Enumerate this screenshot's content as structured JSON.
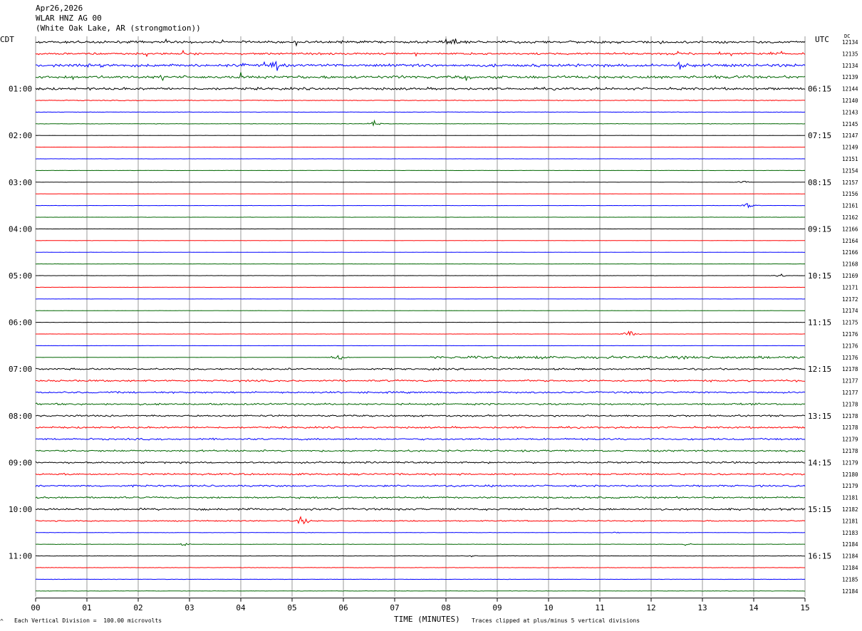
{
  "header": {
    "date": "Apr26,2026",
    "channel": "WLAR HNZ AG 00",
    "location": "(White Oak Lake, AR (strongmotion))"
  },
  "left_tz": "CDT",
  "right_tz": "UTC",
  "dc_label": "DC",
  "footer": {
    "scale_note": "Each Vertical Division =  100.00 microvolts",
    "clip_note": "Traces clipped at plus/minus 5 vertical divisions",
    "corner_mark": "^"
  },
  "colors": {
    "trace_cycle": [
      "#000000",
      "#ff0000",
      "#0000ff",
      "#006600"
    ],
    "grid": "#9a9a9a"
  },
  "chart_data": {
    "type": "helicorder",
    "xlabel": "TIME (MINUTES)",
    "xlim": [
      0,
      15
    ],
    "x_ticks": [
      "00",
      "01",
      "02",
      "03",
      "04",
      "05",
      "06",
      "07",
      "08",
      "09",
      "10",
      "11",
      "12",
      "13",
      "14",
      "15"
    ],
    "left_time_labels": [
      "01:00",
      "02:00",
      "03:00",
      "04:00",
      "05:00",
      "06:00",
      "07:00",
      "08:00",
      "09:00",
      "10:00",
      "11:00"
    ],
    "right_time_labels": [
      "06:15",
      "07:15",
      "08:15",
      "09:15",
      "10:15",
      "11:15",
      "12:15",
      "13:15",
      "14:15",
      "15:15",
      "16:15"
    ],
    "row_minutes": 15,
    "row_count": 48,
    "dc_values": [
      "12134",
      "12135",
      "12134",
      "12139",
      "12144",
      "12140",
      "12143",
      "12145",
      "12147",
      "12149",
      "12151",
      "12154",
      "12157",
      "12156",
      "12161",
      "12162",
      "12166",
      "12164",
      "12166",
      "12168",
      "12169",
      "12171",
      "12172",
      "12174",
      "12175",
      "12176",
      "12176",
      "12176",
      "12178",
      "12177",
      "12177",
      "12178",
      "12178",
      "12178",
      "12179",
      "12178",
      "12179",
      "12180",
      "12179",
      "12181",
      "12182",
      "12181",
      "12183",
      "12184",
      "12184",
      "12184",
      "12185",
      "12184"
    ],
    "noise_amplitude_divisions": [
      3,
      2.5,
      3.5,
      3.5,
      3,
      1,
      0.6,
      0.6,
      0.3,
      0.3,
      0.3,
      0.3,
      0.3,
      0.3,
      0.3,
      0.3,
      0.3,
      0.3,
      0.3,
      0.3,
      0.3,
      0.3,
      0.3,
      0.3,
      0.3,
      0.3,
      0.3,
      0.3,
      2.2,
      2.2,
      2.2,
      2.2,
      2.2,
      2.2,
      2.2,
      2.2,
      2.2,
      2.2,
      2.2,
      2.2,
      2.5,
      1.5,
      0.5,
      0.5,
      0.5,
      0.5,
      0.5,
      0.5
    ],
    "events": [
      {
        "row": 0,
        "minute": 8.1,
        "amp": 8
      },
      {
        "row": 2,
        "minute": 4.7,
        "amp": 8
      },
      {
        "row": 2,
        "minute": 12.6,
        "amp": 8
      },
      {
        "row": 7,
        "minute": 6.6,
        "amp": 3
      },
      {
        "row": 12,
        "minute": 13.8,
        "amp": 2
      },
      {
        "row": 14,
        "minute": 13.9,
        "amp": 3
      },
      {
        "row": 20,
        "minute": 14.5,
        "amp": 2
      },
      {
        "row": 25,
        "minute": 11.6,
        "amp": 4
      },
      {
        "row": 27,
        "minute": 5.9,
        "amp": 5
      },
      {
        "row": 41,
        "minute": 5.2,
        "amp": 5
      },
      {
        "row": 42,
        "minute": 11.3,
        "amp": 1
      },
      {
        "row": 43,
        "minute": 2.9,
        "amp": 1.5
      },
      {
        "row": 43,
        "minute": 12.7,
        "amp": 1.5
      },
      {
        "row": 44,
        "minute": 8.5,
        "amp": 1
      }
    ],
    "clip_divisions": 5
  }
}
